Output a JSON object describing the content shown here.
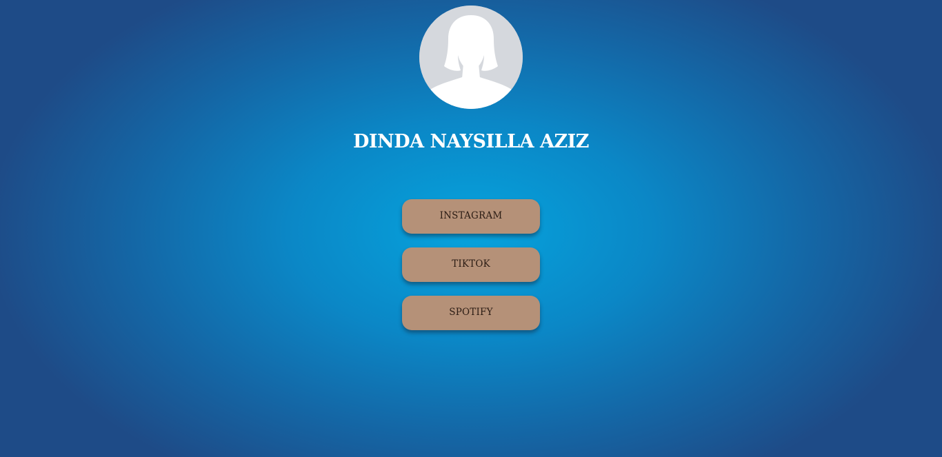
{
  "profile": {
    "name": "DINDA NAYSILLA AZIZ",
    "avatar_icon": "default-female-avatar-icon"
  },
  "links": [
    {
      "label": "INSTAGRAM"
    },
    {
      "label": "TIKTOK"
    },
    {
      "label": "SPOTIFY"
    }
  ],
  "colors": {
    "background_center": "#06a3dd",
    "background_edge": "#1e4b87",
    "button_bg": "#b59178",
    "button_text": "#2b1c14",
    "name_text": "#ffffff"
  }
}
